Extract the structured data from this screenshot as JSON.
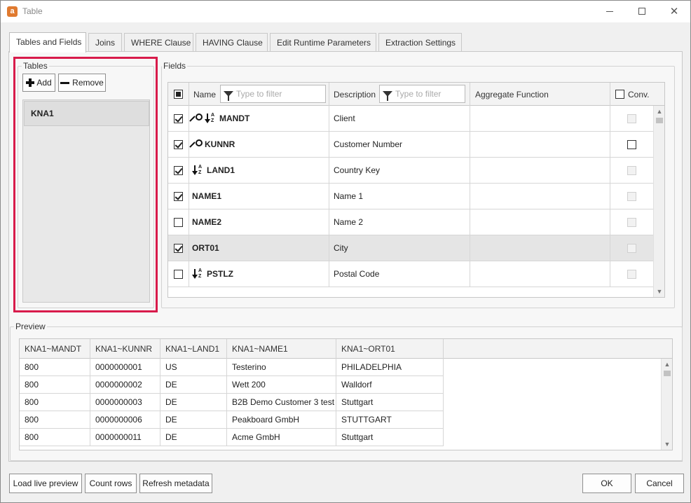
{
  "window": {
    "title": "Table",
    "app_icon_letter": "a",
    "accent_color": "#e07a2f",
    "highlight_color": "#d81b4b"
  },
  "tabs": [
    {
      "label": "Tables and Fields",
      "active": true
    },
    {
      "label": "Joins"
    },
    {
      "label": "WHERE Clause"
    },
    {
      "label": "HAVING Clause"
    },
    {
      "label": "Edit Runtime Parameters"
    },
    {
      "label": "Extraction Settings"
    }
  ],
  "tables_group": {
    "label": "Tables",
    "add_label": "Add",
    "remove_label": "Remove",
    "items": [
      "KNA1"
    ]
  },
  "fields_group": {
    "label": "Fields",
    "columns": {
      "name": "Name",
      "name_filter_placeholder": "Type to filter",
      "description": "Description",
      "description_filter_placeholder": "Type to filter",
      "aggregate": "Aggregate Function",
      "conv": "Conv."
    },
    "rows": [
      {
        "checked": true,
        "name": "MANDT",
        "key": true,
        "sort": true,
        "description": "Client",
        "conv": "disabled"
      },
      {
        "checked": true,
        "name": "KUNNR",
        "key": true,
        "sort": false,
        "description": "Customer Number",
        "conv": "enabled"
      },
      {
        "checked": true,
        "name": "LAND1",
        "key": false,
        "sort": true,
        "description": "Country Key",
        "conv": "disabled"
      },
      {
        "checked": true,
        "name": "NAME1",
        "key": false,
        "sort": false,
        "description": "Name 1",
        "conv": "disabled"
      },
      {
        "checked": false,
        "name": "NAME2",
        "key": false,
        "sort": false,
        "description": "Name 2",
        "conv": "disabled"
      },
      {
        "checked": true,
        "name": "ORT01",
        "key": false,
        "sort": false,
        "description": "City",
        "conv": "disabled",
        "selected": true
      },
      {
        "checked": false,
        "name": "PSTLZ",
        "key": false,
        "sort": true,
        "description": "Postal Code",
        "conv": "disabled"
      }
    ]
  },
  "preview": {
    "label": "Preview",
    "columns": [
      "KNA1~MANDT",
      "KNA1~KUNNR",
      "KNA1~LAND1",
      "KNA1~NAME1",
      "KNA1~ORT01"
    ],
    "rows": [
      [
        "800",
        "0000000001",
        "US",
        "Testerino",
        "PHILADELPHIA"
      ],
      [
        "800",
        "0000000002",
        "DE",
        "Wett 200",
        "Walldorf"
      ],
      [
        "800",
        "0000000003",
        "DE",
        "B2B Demo Customer 3 test",
        "Stuttgart"
      ],
      [
        "800",
        "0000000006",
        "DE",
        "Peakboard GmbH",
        "STUTTGART"
      ],
      [
        "800",
        "0000000011",
        "DE",
        "Acme GmbH",
        "Stuttgart"
      ]
    ]
  },
  "footer": {
    "load_preview_label": "Load live preview",
    "count_rows_label": "Count rows",
    "refresh_label": "Refresh metadata",
    "ok_label": "OK",
    "cancel_label": "Cancel"
  }
}
